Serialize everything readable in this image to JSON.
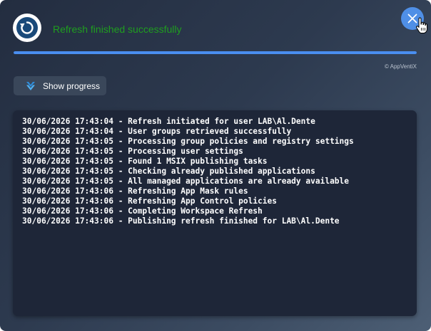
{
  "status": {
    "text": "Refresh finished successfully",
    "color": "#1f9e1f"
  },
  "logo": {
    "icon": "refresh-icon",
    "color": "#1a4a7a"
  },
  "close": {
    "icon": "close-icon",
    "color": "#4f8fe6"
  },
  "progress": {
    "value": 1.0,
    "color": "#4a8ef0"
  },
  "copyright": "© AppVentiX",
  "show_progress": {
    "label": "Show progress",
    "icon": "chevron-double-down-icon",
    "color": "#3fa4f0"
  },
  "log": {
    "lines": [
      "30/06/2026 17:43:04 - Refresh initiated for user LAB\\Al.Dente",
      "30/06/2026 17:43:04 - User groups retrieved successfully",
      "30/06/2026 17:43:05 - Processing group policies and registry settings",
      "30/06/2026 17:43:05 - Processing user settings",
      "30/06/2026 17:43:05 - Found 1 MSIX publishing tasks",
      "30/06/2026 17:43:05 - Checking already published applications",
      "30/06/2026 17:43:05 - All managed applications are already available",
      "30/06/2026 17:43:06 - Refreshing App Mask rules",
      "30/06/2026 17:43:06 - Refreshing App Control policies",
      "30/06/2026 17:43:06 - Completing Workspace Refresh",
      "30/06/2026 17:43:06 - Publishing refresh finished for LAB\\Al.Dente"
    ]
  }
}
